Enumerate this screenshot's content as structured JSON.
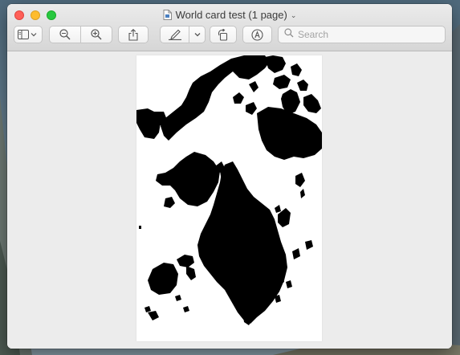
{
  "window": {
    "title": "World card test (1 page)"
  },
  "toolbar": {
    "buttons": [
      {
        "name": "sidebar-view-button",
        "icon": "sidebar-icon"
      },
      {
        "name": "zoom-out-button",
        "icon": "zoom-out-icon"
      },
      {
        "name": "zoom-in-button",
        "icon": "zoom-in-icon"
      },
      {
        "name": "share-button",
        "icon": "share-icon"
      },
      {
        "name": "markup-pen-button",
        "icon": "pen-icon"
      },
      {
        "name": "rotate-button",
        "icon": "rotate-icon"
      },
      {
        "name": "annotate-button",
        "icon": "markup-circle-icon"
      }
    ],
    "search": {
      "placeholder": "Search",
      "value": ""
    }
  },
  "document": {
    "page_image": "world-map-silhouette",
    "colors": {
      "page": "#ffffff",
      "land": "#000000"
    }
  }
}
